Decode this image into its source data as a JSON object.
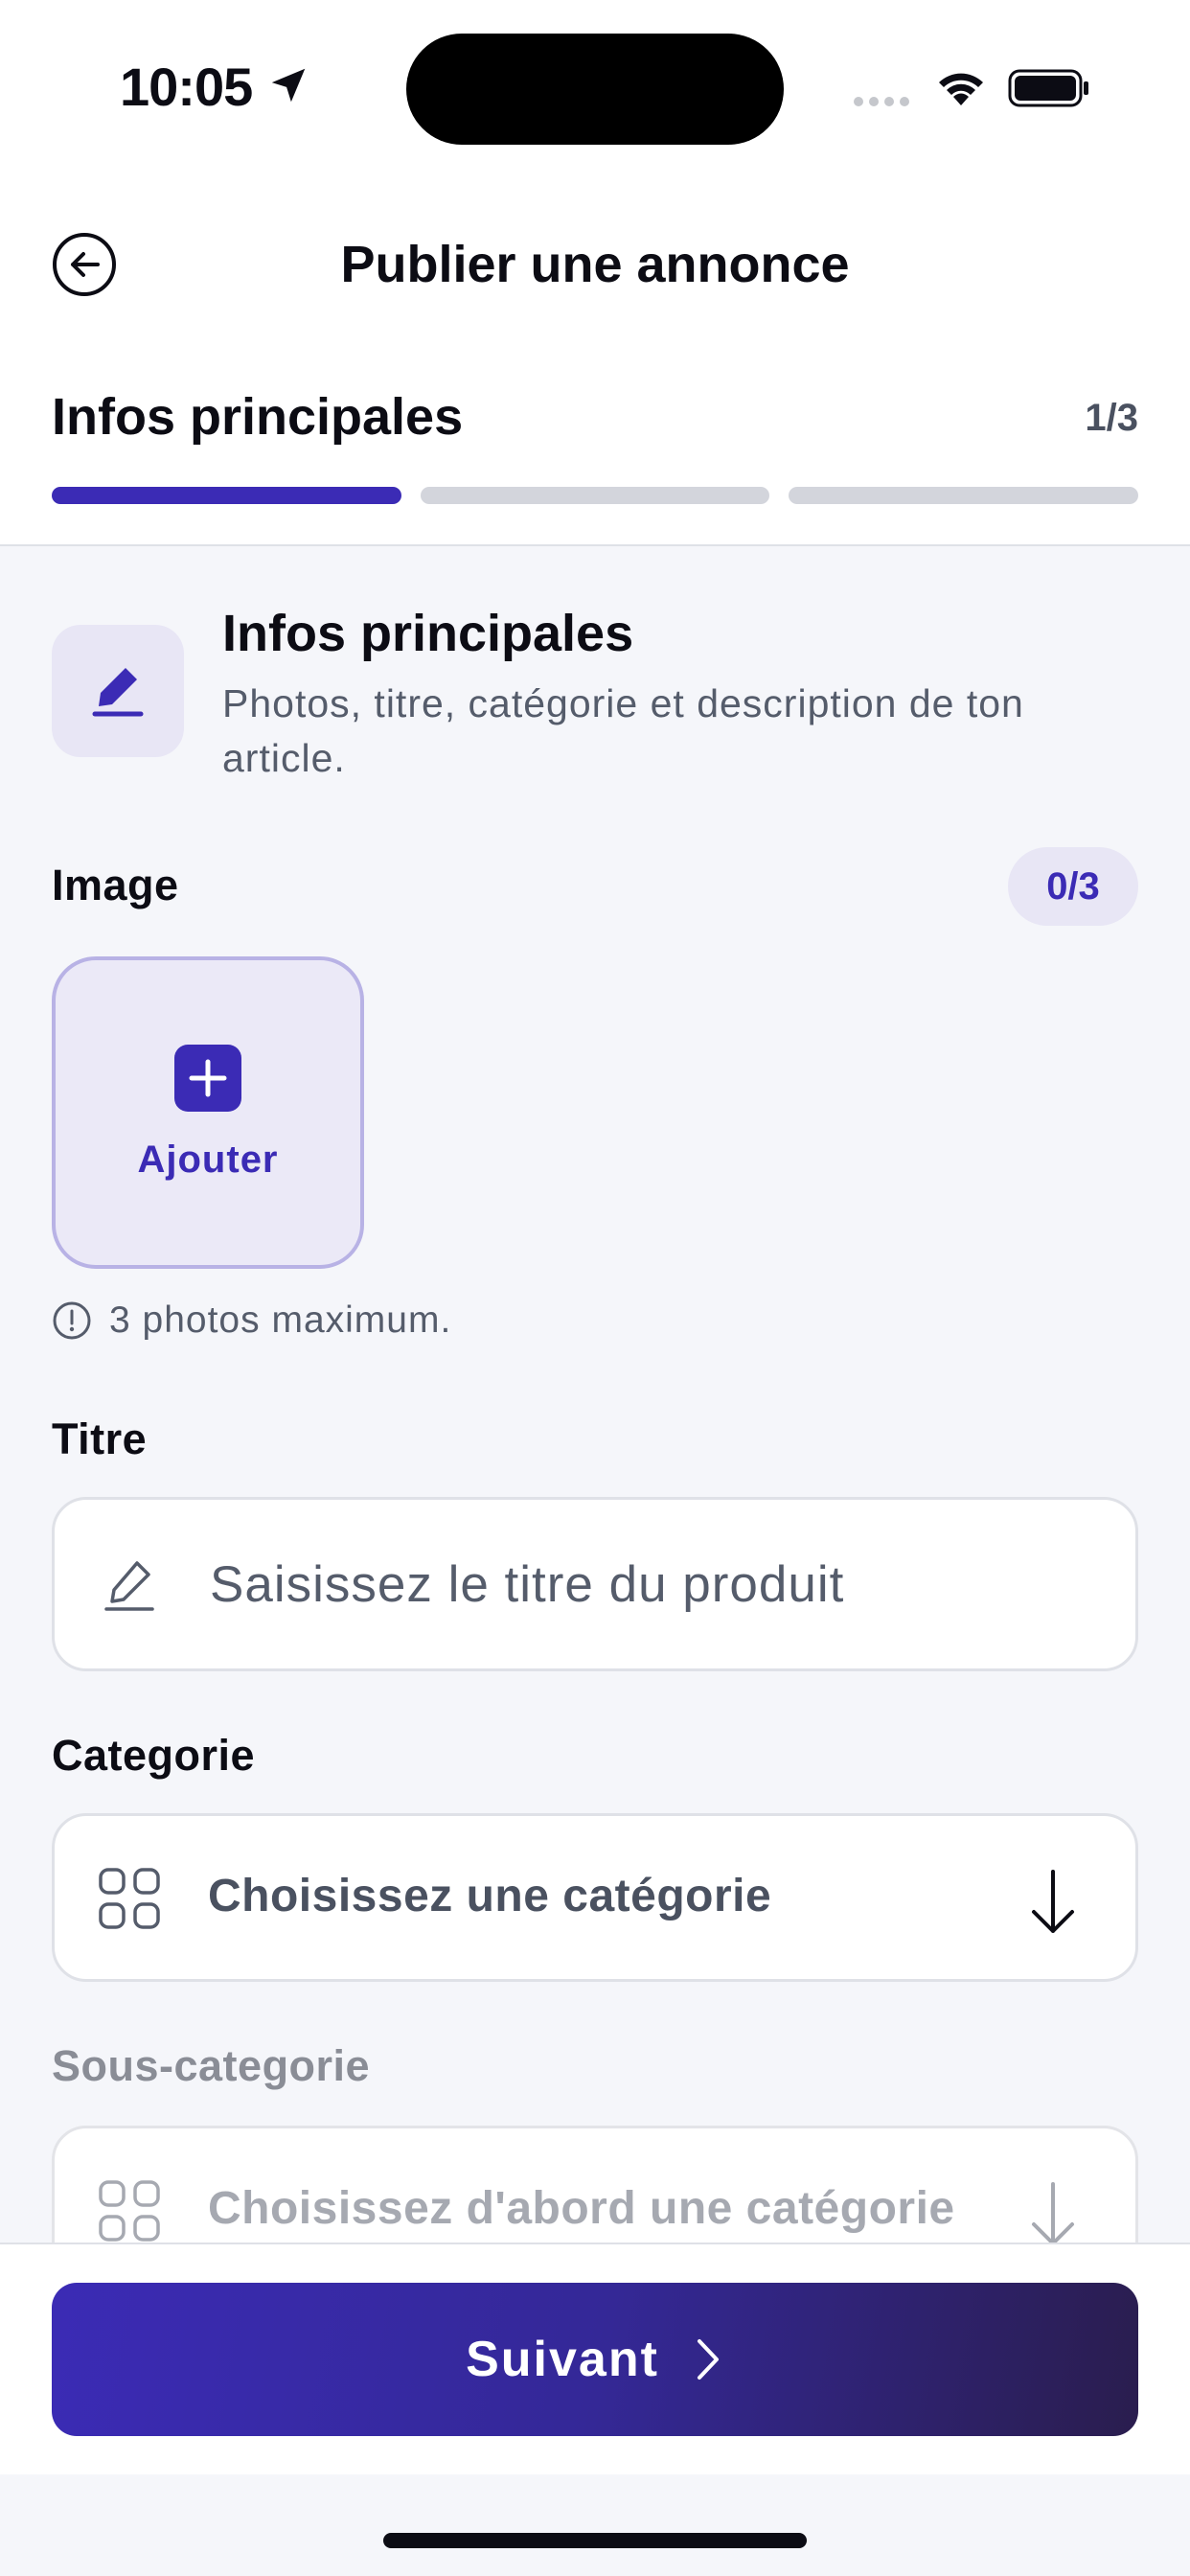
{
  "status_bar": {
    "time": "10:05",
    "icons": [
      "location-arrow-icon",
      "cellular-signal-icon",
      "wifi-icon",
      "battery-icon"
    ]
  },
  "header": {
    "title": "Publier une annonce",
    "back_icon": "back-arrow-circle-icon",
    "step_title": "Infos principales",
    "step_counter": "1/3",
    "progress": {
      "current": 1,
      "total": 3
    }
  },
  "intro": {
    "icon": "edit-pen-icon",
    "title": "Infos principales",
    "description": "Photos, titre, catégorie et description de ton article."
  },
  "image_section": {
    "label": "Image",
    "count_badge": "0/3",
    "add_label": "Ajouter",
    "hint": "3 photos maximum."
  },
  "title_field": {
    "label": "Titre",
    "placeholder": "Saisissez le titre du produit",
    "value": ""
  },
  "category_field": {
    "label": "Categorie",
    "placeholder": "Choisissez une catégorie"
  },
  "subcategory_field": {
    "label": "Sous-categorie",
    "placeholder": "Choisissez d'abord une catégorie"
  },
  "footer": {
    "next_label": "Suivant"
  },
  "colors": {
    "accent": "#3b2bb5",
    "accent_light": "#e8e6f5",
    "button_gradient_end": "#2a1d4e",
    "background": "#f5f6fa"
  }
}
